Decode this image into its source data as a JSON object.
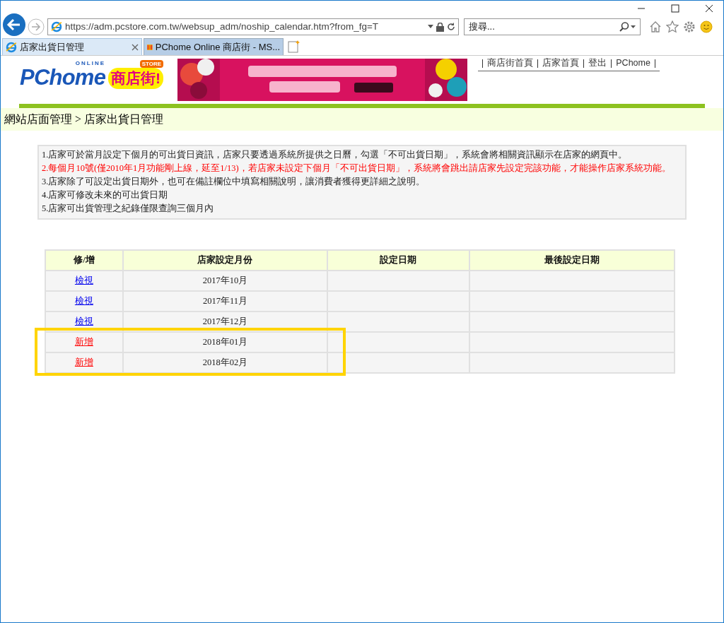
{
  "browser": {
    "address": "https://adm.pcstore.com.tw/websup_adm/noship_calendar.htm?from_fg=T",
    "search_placeholder": "搜尋...",
    "tabs": [
      {
        "label": "店家出貨日管理",
        "selected": true
      },
      {
        "label": "PChome Online 商店街 - MS...",
        "selected": false
      }
    ]
  },
  "header": {
    "logo": {
      "tag": "ONLINE",
      "brand": "PChome",
      "badge": "STORE",
      "store": "商店街!"
    },
    "banner": {
      "kind": "picture"
    },
    "links": [
      "商店街首頁",
      "店家首頁",
      "登出",
      "PChome"
    ]
  },
  "breadcrumb": "網站店面管理 > 店家出貨日管理",
  "notes": [
    {
      "text": "1.店家可於當月設定下個月的可出貨日資訊，店家只要透過系統所提供之日曆，勾選「不可出貨日期」，系統會將相關資訊顯示在店家的網頁中。",
      "alert": false
    },
    {
      "text": "2.每個月10號(僅2010年1月功能剛上線，延至1/13)，若店家未設定下個月「不可出貨日期」，系統將會跳出請店家先設定完該功能，才能操作店家系統功能。",
      "alert": true
    },
    {
      "text": "3.店家除了可設定出貨日期外，也可在備註欄位中填寫相關說明，讓消費者獲得更詳細之說明。",
      "alert": false
    },
    {
      "text": "4.店家可修改未來的可出貨日期",
      "alert": false
    },
    {
      "text": "5.店家可出貨管理之紀錄僅限查詢三個月內",
      "alert": false
    }
  ],
  "table": {
    "columns": [
      "修/增",
      "店家設定月份",
      "設定日期",
      "最後設定日期"
    ],
    "rows": [
      {
        "action": "檢視",
        "kind": "view",
        "month": "2017年10月",
        "highlighted": false
      },
      {
        "action": "檢視",
        "kind": "view",
        "month": "2017年11月",
        "highlighted": false
      },
      {
        "action": "檢視",
        "kind": "view",
        "month": "2017年12月",
        "highlighted": false
      },
      {
        "action": "新增",
        "kind": "add",
        "month": "2018年01月",
        "highlighted": true
      },
      {
        "action": "新增",
        "kind": "add",
        "month": "2018年02月",
        "highlighted": true
      }
    ]
  }
}
